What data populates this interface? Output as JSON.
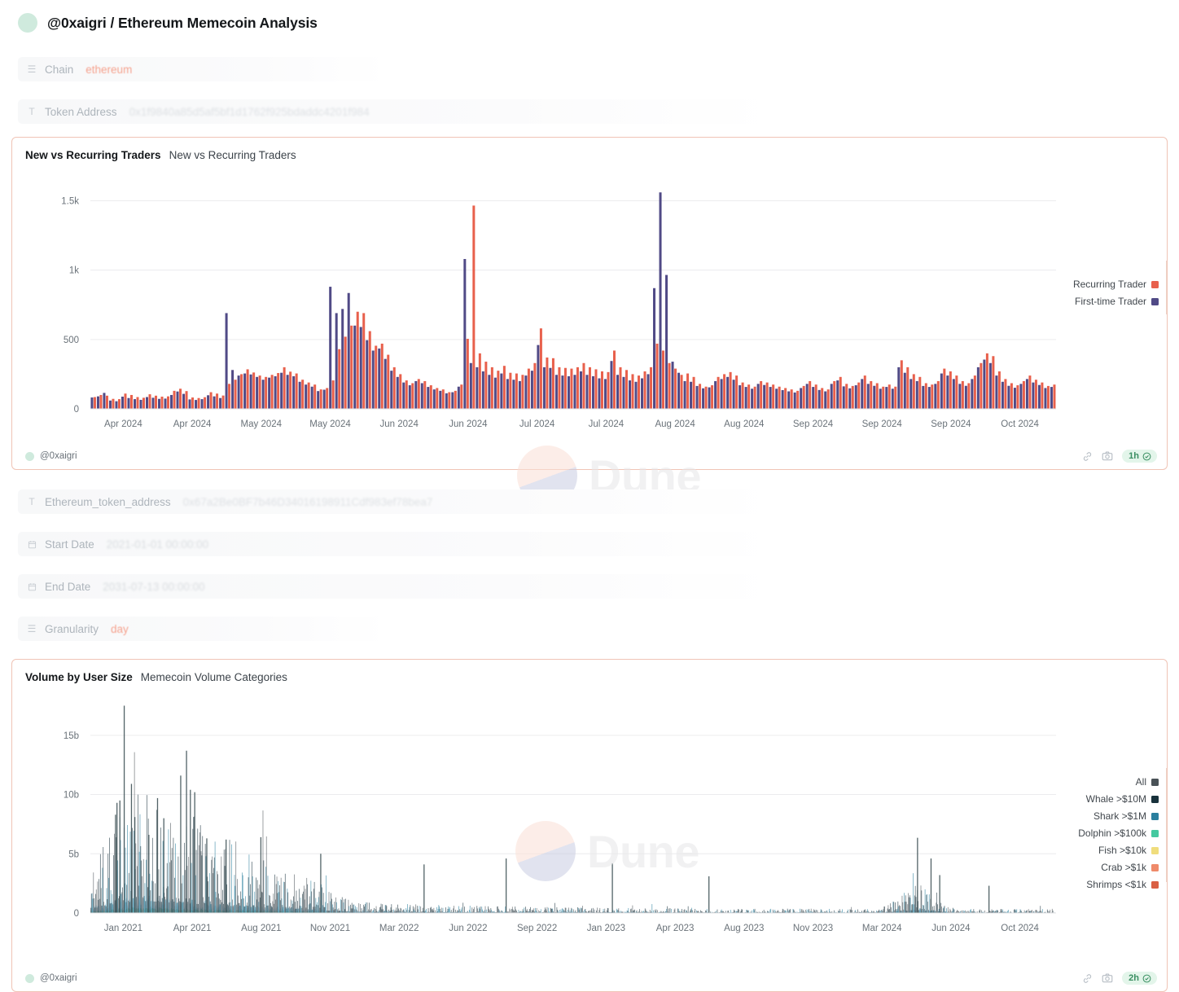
{
  "header": {
    "avatar": "avatar-circle",
    "title": "@0xaigri / Ethereum Memecoin Analysis"
  },
  "params_top": [
    {
      "icon": "list-icon",
      "icon_glyph": "☰",
      "label": "Chain",
      "value": "ethereum",
      "style": "accent"
    },
    {
      "icon": "text-icon",
      "icon_glyph": "T",
      "label": "Token Address",
      "value": "0x1f9840a85d5af5bf1d1762f925bdaddc4201f984",
      "style": "hex"
    }
  ],
  "params_bottom": [
    {
      "icon": "text-icon",
      "icon_glyph": "T",
      "label": "Ethereum_token_address",
      "value": "0x67a2Be0BF7b46D34016198911Cdf983ef78bea7",
      "style": "hex"
    },
    {
      "icon": "calendar-icon",
      "icon_glyph": "Ὕ3",
      "label": "Start Date",
      "value": "2021-01-01 00:00:00",
      "style": "date"
    },
    {
      "icon": "calendar-icon",
      "icon_glyph": "Ὕ3",
      "label": "End Date",
      "value": "2031-07-13 00:00:00",
      "style": "date"
    },
    {
      "icon": "list-icon",
      "icon_glyph": "☰",
      "label": "Granularity",
      "value": "day",
      "style": "accent"
    }
  ],
  "cards": [
    {
      "title": "New vs Recurring Traders",
      "subtitle": "New vs Recurring Traders",
      "footer_user": "@0xaigri",
      "refresh": "1h",
      "tools": [
        "link-icon",
        "camera-icon"
      ]
    },
    {
      "title": "Volume by User Size",
      "subtitle": "Memecoin Volume Categories",
      "footer_user": "@0xaigri",
      "refresh": "2h",
      "tools": [
        "link-icon",
        "camera-icon"
      ]
    }
  ],
  "watermark": {
    "text": "Dune"
  },
  "chart_data": [
    {
      "type": "bar",
      "title": "New vs Recurring Traders",
      "xlabel": "",
      "ylabel": "",
      "ylim": [
        0,
        1620
      ],
      "yticks": [
        0,
        500,
        1000,
        1500
      ],
      "ytick_labels": [
        "0",
        "500",
        "1k",
        "1.5k"
      ],
      "grid": true,
      "legend_position": "right",
      "xtick_labels": [
        "Apr 2024",
        "Apr 2024",
        "May 2024",
        "May 2024",
        "Jun 2024",
        "Jun 2024",
        "Jul 2024",
        "Jul 2024",
        "Aug 2024",
        "Aug 2024",
        "Sep 2024",
        "Sep 2024",
        "Sep 2024",
        "Oct 2024"
      ],
      "colors": {
        "Recurring Trader": "#e8604c",
        "First-time Trader": "#504a86"
      },
      "series": [
        {
          "name": "Recurring Trader",
          "values": [
            85,
            100,
            95,
            72,
            70,
            110,
            100,
            85,
            80,
            105,
            95,
            88,
            90,
            130,
            145,
            128,
            82,
            78,
            84,
            120,
            110,
            96,
            180,
            210,
            250,
            285,
            262,
            240,
            230,
            245,
            258,
            300,
            268,
            255,
            210,
            190,
            175,
            140,
            150,
            205,
            430,
            520,
            600,
            700,
            690,
            560,
            455,
            470,
            390,
            300,
            250,
            205,
            185,
            215,
            200,
            170,
            150,
            140,
            120,
            130,
            175,
            505,
            1465,
            400,
            340,
            300,
            275,
            310,
            260,
            255,
            245,
            290,
            330,
            580,
            370,
            365,
            300,
            295,
            290,
            300,
            330,
            300,
            285,
            270,
            265,
            420,
            300,
            280,
            250,
            240,
            270,
            300,
            470,
            420,
            330,
            290,
            245,
            255,
            230,
            180,
            160,
            170,
            230,
            250,
            265,
            240,
            190,
            175,
            160,
            200,
            190,
            175,
            160,
            150,
            140,
            130,
            165,
            200,
            175,
            150,
            140,
            200,
            230,
            180,
            165,
            190,
            240,
            200,
            185,
            160,
            175,
            160,
            350,
            300,
            250,
            230,
            185,
            175,
            200,
            290,
            270,
            240,
            200,
            185,
            240,
            330,
            400,
            380,
            270,
            215,
            185,
            170,
            200,
            240,
            210,
            190,
            165,
            175
          ]
        },
        {
          "name": "First-time Trader",
          "values": [
            82,
            90,
            115,
            60,
            55,
            88,
            78,
            70,
            65,
            85,
            80,
            72,
            74,
            100,
            125,
            108,
            68,
            64,
            70,
            98,
            90,
            78,
            690,
            280,
            240,
            255,
            248,
            230,
            210,
            225,
            235,
            260,
            245,
            235,
            195,
            175,
            160,
            128,
            138,
            880,
            690,
            720,
            835,
            600,
            590,
            495,
            420,
            435,
            360,
            275,
            230,
            190,
            170,
            200,
            185,
            158,
            140,
            130,
            112,
            120,
            160,
            1080,
            330,
            300,
            270,
            245,
            225,
            255,
            215,
            210,
            200,
            240,
            275,
            460,
            300,
            295,
            245,
            240,
            235,
            245,
            270,
            245,
            235,
            220,
            215,
            345,
            245,
            230,
            205,
            195,
            220,
            250,
            870,
            1560,
            965,
            340,
            260,
            200,
            195,
            165,
            148,
            155,
            200,
            215,
            230,
            210,
            170,
            158,
            145,
            180,
            172,
            158,
            145,
            135,
            126,
            118,
            150,
            180,
            158,
            136,
            126,
            180,
            205,
            162,
            148,
            170,
            215,
            180,
            166,
            145,
            158,
            145,
            300,
            260,
            215,
            200,
            165,
            158,
            180,
            255,
            240,
            215,
            180,
            166,
            215,
            300,
            355,
            330,
            240,
            195,
            166,
            152,
            180,
            215,
            190,
            172,
            150,
            158
          ]
        }
      ]
    },
    {
      "type": "area",
      "title": "Volume by User Size",
      "xlabel": "",
      "ylabel": "",
      "ylim": [
        0,
        17600
      ],
      "yticks": [
        0,
        5000,
        10000,
        15000
      ],
      "ytick_labels": [
        "0",
        "5b",
        "10b",
        "15b"
      ],
      "grid": true,
      "legend_position": "right",
      "xtick_labels": [
        "Jan 2021",
        "Apr 2021",
        "Aug 2021",
        "Nov 2021",
        "Mar 2022",
        "Jun 2022",
        "Sep 2022",
        "Jan 2023",
        "Apr 2023",
        "Aug 2023",
        "Nov 2023",
        "Mar 2024",
        "Jun 2024",
        "Oct 2024"
      ],
      "legend_entries": [
        {
          "label": "All",
          "color": "#4a5257"
        },
        {
          "label": "Whale >$10M",
          "color": "#18313b"
        },
        {
          "label": "Shark >$1M",
          "color": "#2a7f9e"
        },
        {
          "label": "Dolphin >$100k",
          "color": "#45c9a0"
        },
        {
          "label": "Fish >$10k",
          "color": "#f0dd7d"
        },
        {
          "label": "Crab >$1k",
          "color": "#ef8a6a"
        },
        {
          "label": "Shrimps <$1k",
          "color": "#d95f43"
        }
      ],
      "notes": "Dense daily spikes; major peak ~17.5b near Feb 2021, secondary ~13.7b near Apr 2021, a ~6.3b spike near Mar 2024; baseline fill under ~1b for most of 2022-2024."
    }
  ]
}
